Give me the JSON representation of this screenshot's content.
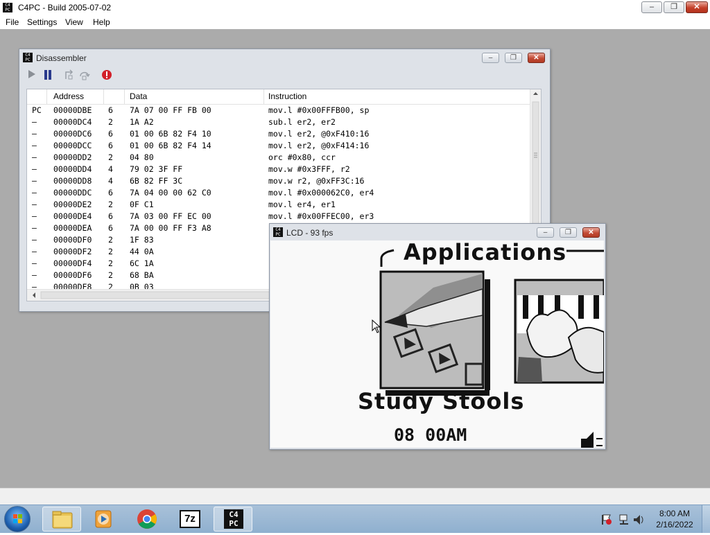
{
  "window": {
    "title": "C4PC - Build 2005-07-02",
    "icon_text": "C4PC"
  },
  "caption_buttons": {
    "minimize": "–",
    "maximize": "❐",
    "close": "✕"
  },
  "menu": [
    "File",
    "Settings",
    "View",
    "Help"
  ],
  "disassembler": {
    "title": "Disassembler",
    "toolbar": [
      "play-icon",
      "pause-icon",
      "step-into-icon",
      "step-over-icon",
      "stop-icon"
    ],
    "columns": [
      "Address",
      "Data",
      "Instruction"
    ],
    "rows": [
      {
        "mark": "PC",
        "address": "00000DBE",
        "len": "6",
        "data": "7A 07 00 FF FB 00",
        "instr": "mov.l #0x00FFFB00, sp"
      },
      {
        "mark": "–",
        "address": "00000DC4",
        "len": "2",
        "data": "1A A2",
        "instr": "sub.l er2, er2"
      },
      {
        "mark": "–",
        "address": "00000DC6",
        "len": "6",
        "data": "01 00 6B 82 F4 10",
        "instr": "mov.l er2, @0xF410:16"
      },
      {
        "mark": "–",
        "address": "00000DCC",
        "len": "6",
        "data": "01 00 6B 82 F4 14",
        "instr": "mov.l er2, @0xF414:16"
      },
      {
        "mark": "–",
        "address": "00000DD2",
        "len": "2",
        "data": "04 80",
        "instr": "orc #0x80, ccr"
      },
      {
        "mark": "–",
        "address": "00000DD4",
        "len": "4",
        "data": "79 02 3F FF",
        "instr": "mov.w #0x3FFF, r2"
      },
      {
        "mark": "–",
        "address": "00000DD8",
        "len": "4",
        "data": "6B 82 FF 3C",
        "instr": "mov.w r2, @0xFF3C:16"
      },
      {
        "mark": "–",
        "address": "00000DDC",
        "len": "6",
        "data": "7A 04 00 00 62 C0",
        "instr": "mov.l #0x000062C0, er4"
      },
      {
        "mark": "–",
        "address": "00000DE2",
        "len": "2",
        "data": "0F C1",
        "instr": "mov.l er4, er1"
      },
      {
        "mark": "–",
        "address": "00000DE4",
        "len": "6",
        "data": "7A 03 00 FF EC 00",
        "instr": "mov.l #0x00FFEC00, er3"
      },
      {
        "mark": "–",
        "address": "00000DEA",
        "len": "6",
        "data": "7A 00 00 FF F3 A8",
        "instr": ""
      },
      {
        "mark": "–",
        "address": "00000DF0",
        "len": "2",
        "data": "1F 83",
        "instr": ""
      },
      {
        "mark": "–",
        "address": "00000DF2",
        "len": "2",
        "data": "44 0A",
        "instr": ""
      },
      {
        "mark": "–",
        "address": "00000DF4",
        "len": "2",
        "data": "6C 1A",
        "instr": ""
      },
      {
        "mark": "–",
        "address": "00000DF6",
        "len": "2",
        "data": "68 BA",
        "instr": ""
      },
      {
        "mark": "–",
        "address": "00000DF8",
        "len": "2",
        "data": "0B 03",
        "instr": ""
      }
    ]
  },
  "lcd": {
    "title": "LCD - 93 fps",
    "heading": "Applications",
    "app_name": "Study Stools",
    "time": "08 00AM"
  },
  "taskbar": {
    "apps": [
      "start-orb",
      "file-explorer",
      "media-player",
      "chrome",
      "7-zip",
      "c4pc"
    ],
    "seven_zip_label": "7z",
    "clock_time": "8:00 AM",
    "clock_date": "2/16/2022"
  },
  "colors": {
    "mdi_background": "#ababab",
    "taskbar": "#9bb8d4",
    "close_red": "#c4412b"
  }
}
